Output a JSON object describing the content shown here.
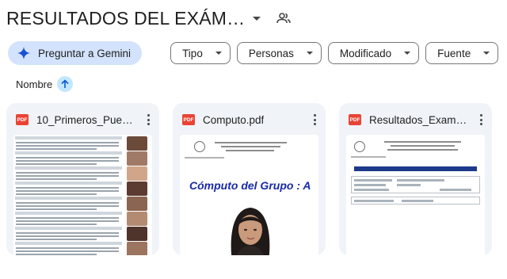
{
  "header": {
    "title": "RESULTADOS DEL EXÁM…"
  },
  "filters": {
    "gemini_label": "Preguntar a Gemini",
    "chips": [
      "Tipo",
      "Personas",
      "Modificado",
      "Fuente"
    ]
  },
  "sort": {
    "label": "Nombre",
    "direction": "ascending"
  },
  "files": [
    {
      "name": "10_Primeros_Puest…",
      "type_badge": "PDF"
    },
    {
      "name": "Computo.pdf",
      "type_badge": "PDF",
      "thumb_heading": "Cómputo del Grupo : A"
    },
    {
      "name": "Resultados_Examen…",
      "type_badge": "PDF"
    }
  ],
  "colors": {
    "gemini_chip": "#d3e3fd",
    "card_bg": "#f0f4f9",
    "sort_accent": "#c2e7ff",
    "pdf_red": "#ea4335",
    "thumb_heading": "#1a2aa8"
  },
  "icons": {
    "people": "people-icon",
    "spark": "gemini-spark-icon",
    "sort": "arrow-up-icon",
    "more": "more-vert-icon"
  }
}
